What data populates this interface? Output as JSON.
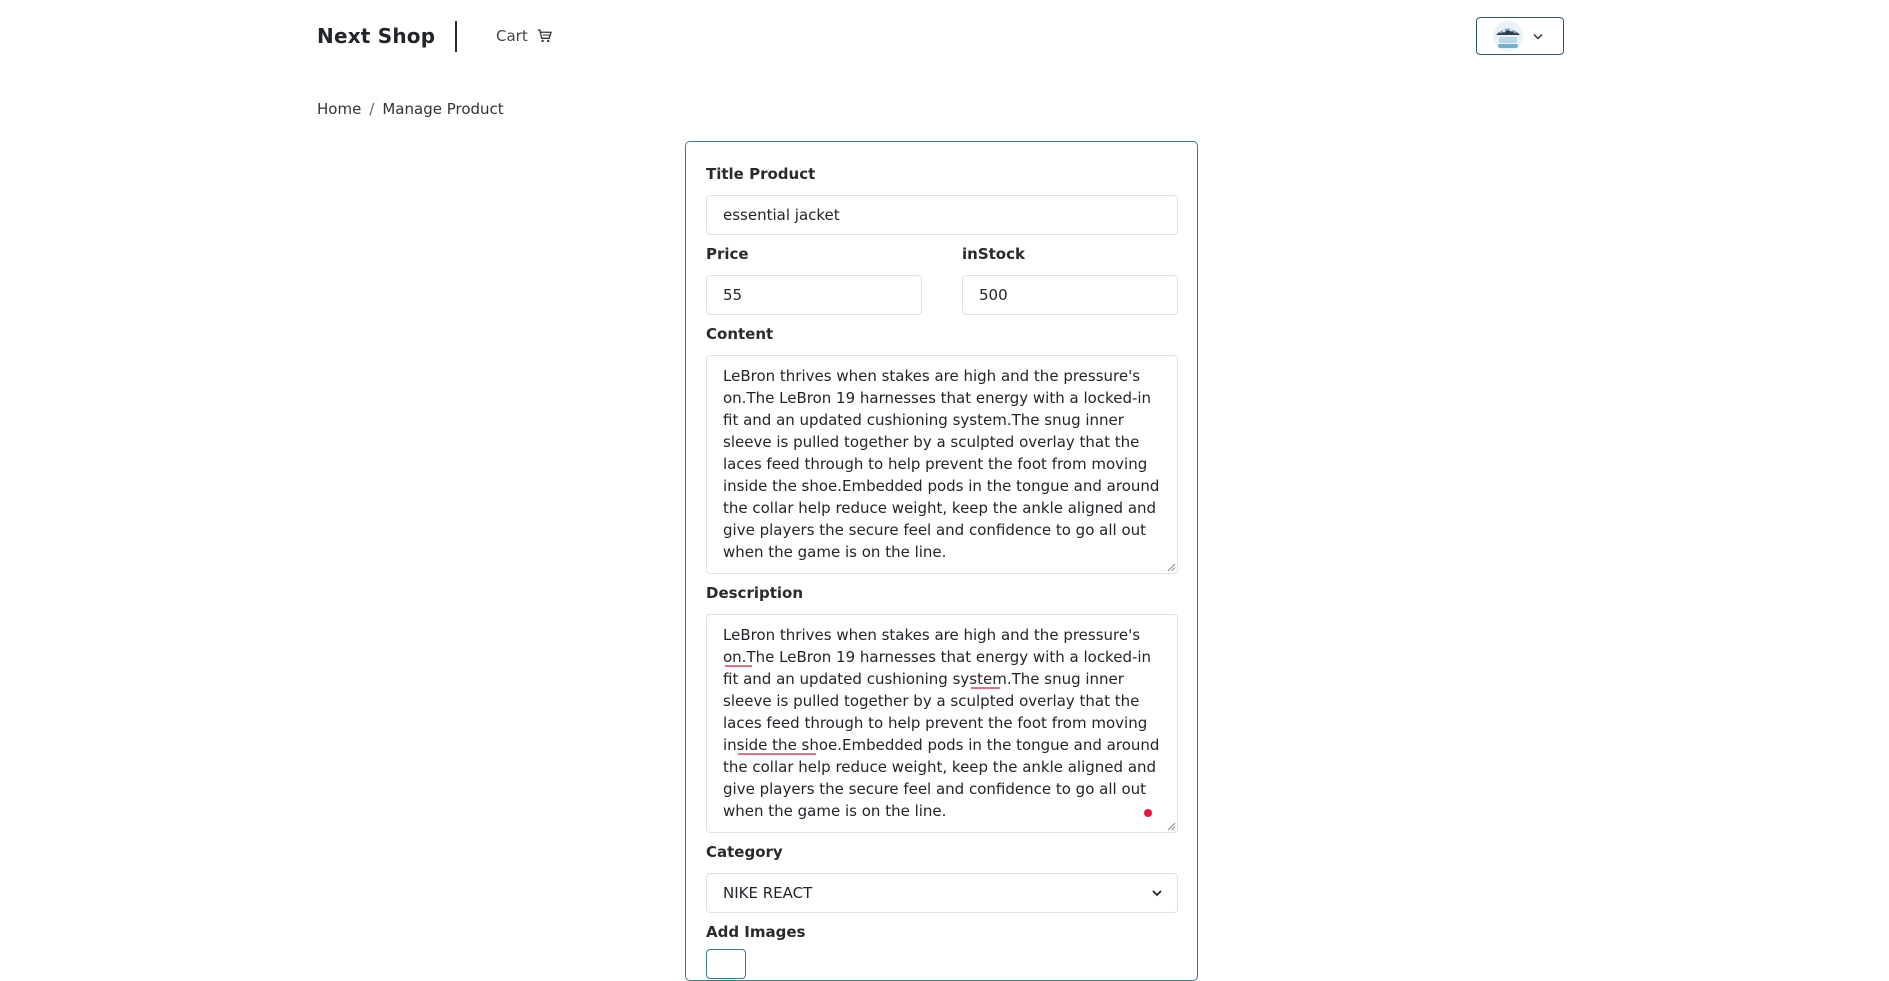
{
  "navbar": {
    "brand": "Next Shop",
    "cart_label": "Cart",
    "cart_icon": "cart-icon",
    "user_menu_icon": "chevron-down-icon"
  },
  "breadcrumb": {
    "home": "Home",
    "separator": "/",
    "current": "Manage Product"
  },
  "form": {
    "title_label": "Title Product",
    "title_value": "essential jacket",
    "price_label": "Price",
    "price_value": "55",
    "instock_label": "inStock",
    "instock_value": "500",
    "content_label": "Content",
    "content_value": "LeBron thrives when stakes are high and the pressure's on.The LeBron 19 harnesses that energy with a locked-in fit and an updated cushioning system.The snug inner sleeve is pulled together by a sculpted overlay that the laces feed through to help prevent the foot from moving inside the shoe.Embedded pods in the tongue and around the collar help reduce weight, keep the ankle aligned and give players the secure feel and confidence to go all out when the game is on the line.",
    "description_label": "Description",
    "description_value": "LeBron thrives when stakes are high and the pressure's on.The LeBron 19 harnesses that energy with a locked-in fit and an updated cushioning system.The snug inner sleeve is pulled together by a sculpted overlay that the laces feed through to help prevent the foot from moving inside the shoe.Embedded pods in the tongue and around the collar help reduce weight, keep the ankle aligned and give players the secure feel and confidence to go all out when the game is on the line.",
    "category_label": "Category",
    "category_value": "NIKE REACT",
    "add_images_label": "Add Images"
  },
  "colors": {
    "accent_border": "#3b7d87",
    "spellcheck": "#e36c86",
    "grammar_dot": "#e8163c"
  }
}
